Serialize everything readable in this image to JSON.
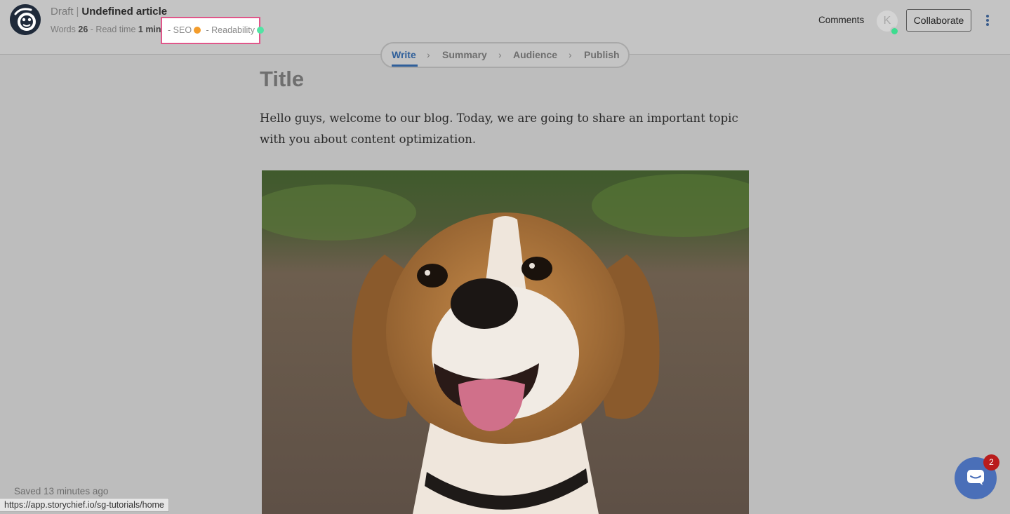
{
  "header": {
    "status": "Draft",
    "separator": "|",
    "article_title": "Undefined article",
    "words_label": "Words",
    "words_count": "26",
    "read_time_label": "Read time",
    "read_time_value": "1 min",
    "seo_label": "SEO",
    "seo_status_color": "#f39c2b",
    "readability_label": "Readability",
    "readability_status_color": "#52e3a4",
    "comments_label": "Comments",
    "avatar_initial": "K",
    "collaborate_label": "Collaborate"
  },
  "steps": [
    {
      "label": "Write",
      "active": true
    },
    {
      "label": "Summary",
      "active": false
    },
    {
      "label": "Audience",
      "active": false
    },
    {
      "label": "Publish",
      "active": false
    }
  ],
  "editor": {
    "title_placeholder": "Title",
    "paragraph": "Hello guys, welcome to our blog. Today, we are going to share an important topic with you about content optimization."
  },
  "footer": {
    "saved_status": "Saved 13 minutes ago",
    "status_url": "https://app.storychief.io/sg-tutorials/home"
  },
  "chat": {
    "unread_count": "2"
  },
  "colors": {
    "accent": "#2f5f9a",
    "highlight_border": "#e0568a",
    "chat_button": "#4a6fb8",
    "badge": "#b91c1c"
  },
  "icons": {
    "logo": "storychief-logo-icon",
    "more": "more-vertical-icon",
    "step_separator": "chevron-right-icon",
    "chat": "chat-bubble-icon"
  }
}
